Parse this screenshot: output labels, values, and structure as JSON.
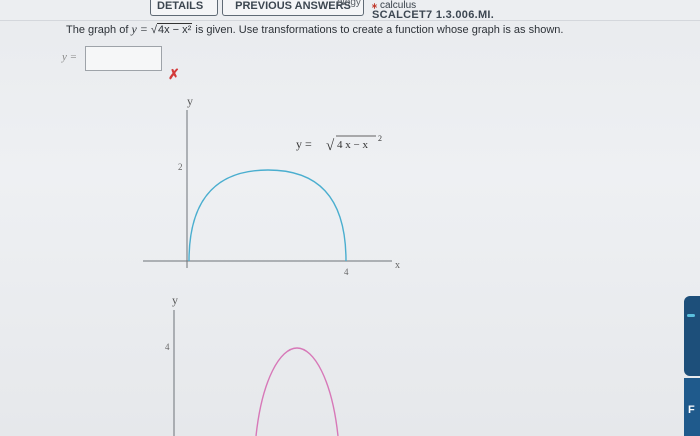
{
  "header": {
    "details_label": "DETAILS",
    "previous_answers_label": "PREVIOUS ANSWERS",
    "top_small": "ology",
    "calculus_link": "calculus",
    "school_code": "SCALCET7 1.3.006.MI."
  },
  "question": {
    "prefix": "The graph of",
    "y_eq": "y =",
    "radical_sign": "√",
    "expr": "4x − x²",
    "suffix": "is given. Use transformations to create a function whose graph is as shown."
  },
  "answer": {
    "label": "y =",
    "value": "",
    "result_mark": "✗"
  },
  "graph1": {
    "y_axis_label": "y",
    "x_axis_label": "x",
    "y_tick": "2",
    "x_tick": "4",
    "curve_label_lhs": "y =",
    "curve_label_expr": "4 x − x",
    "curve_label_exp": "2",
    "curve_color": "#4aaecf"
  },
  "graph2": {
    "y_axis_label": "y",
    "y_tick": "4",
    "curve_color": "#d778b8"
  },
  "sidebar": {
    "tab_letter": "F"
  }
}
